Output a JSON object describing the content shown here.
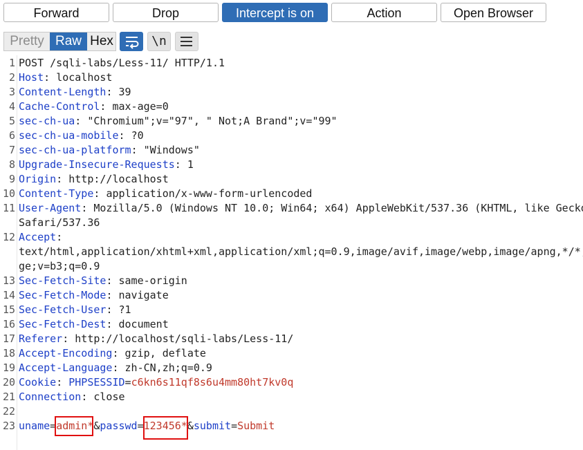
{
  "toolbar": {
    "forward_label": "Forward",
    "drop_label": "Drop",
    "intercept_label": "Intercept is on",
    "action_label": "Action",
    "open_browser_label": "Open Browser"
  },
  "view": {
    "pretty_label": "Pretty",
    "raw_label": "Raw",
    "hex_label": "Hex",
    "newline_label": "\\n"
  },
  "request": {
    "line1": "POST /sqli-labs/Less-11/ HTTP/1.1",
    "headers": [
      {
        "name": "Host",
        "value": "localhost"
      },
      {
        "name": "Content-Length",
        "value": "39"
      },
      {
        "name": "Cache-Control",
        "value": "max-age=0"
      },
      {
        "name": "sec-ch-ua",
        "value": "\"Chromium\";v=\"97\", \" Not;A Brand\";v=\"99\""
      },
      {
        "name": "sec-ch-ua-mobile",
        "value": "?0"
      },
      {
        "name": "sec-ch-ua-platform",
        "value": "\"Windows\""
      },
      {
        "name": "Upgrade-Insecure-Requests",
        "value": "1"
      },
      {
        "name": "Origin",
        "value": "http://localhost"
      },
      {
        "name": "Content-Type",
        "value": "application/x-www-form-urlencoded"
      },
      {
        "name": "User-Agent",
        "value": "Mozilla/5.0 (Windows NT 10.0; Win64; x64) AppleWebKit/537.36 (KHTML, like Gecko"
      },
      {
        "name": "Accept",
        "value": ""
      },
      {
        "name": "Sec-Fetch-Site",
        "value": "same-origin"
      },
      {
        "name": "Sec-Fetch-Mode",
        "value": "navigate"
      },
      {
        "name": "Sec-Fetch-User",
        "value": "?1"
      },
      {
        "name": "Sec-Fetch-Dest",
        "value": "document"
      },
      {
        "name": "Referer",
        "value": "http://localhost/sqli-labs/Less-11/"
      },
      {
        "name": "Accept-Encoding",
        "value": "gzip, deflate"
      },
      {
        "name": "Accept-Language",
        "value": "zh-CN,zh;q=0.9"
      },
      {
        "name": "Cookie",
        "value": ""
      },
      {
        "name": "Connection",
        "value": "close"
      }
    ],
    "ua_cont": "Safari/537.36",
    "accept_cont1": "text/html,application/xhtml+xml,application/xml;q=0.9,image/avif,image/webp,image/apng,*/*;",
    "accept_cont2": "ge;v=b3;q=0.9",
    "cookie": {
      "name": "PHPSESSID",
      "value": "c6kn6s11qf8s6u4mm80ht7kv0q"
    },
    "body": {
      "p1_name": "uname",
      "p1_value": "admin*",
      "sep1": "&",
      "p2_name": "passwd",
      "p2_value": "123456*",
      "sep2": "&",
      "p3_name": "submit",
      "p3_value": "Submit",
      "eq": "="
    }
  },
  "line_numbers": [
    "1",
    "2",
    "3",
    "4",
    "5",
    "6",
    "7",
    "8",
    "9",
    "10",
    "11",
    "12",
    "13",
    "14",
    "15",
    "16",
    "17",
    "18",
    "19",
    "20",
    "21",
    "22",
    "23"
  ]
}
